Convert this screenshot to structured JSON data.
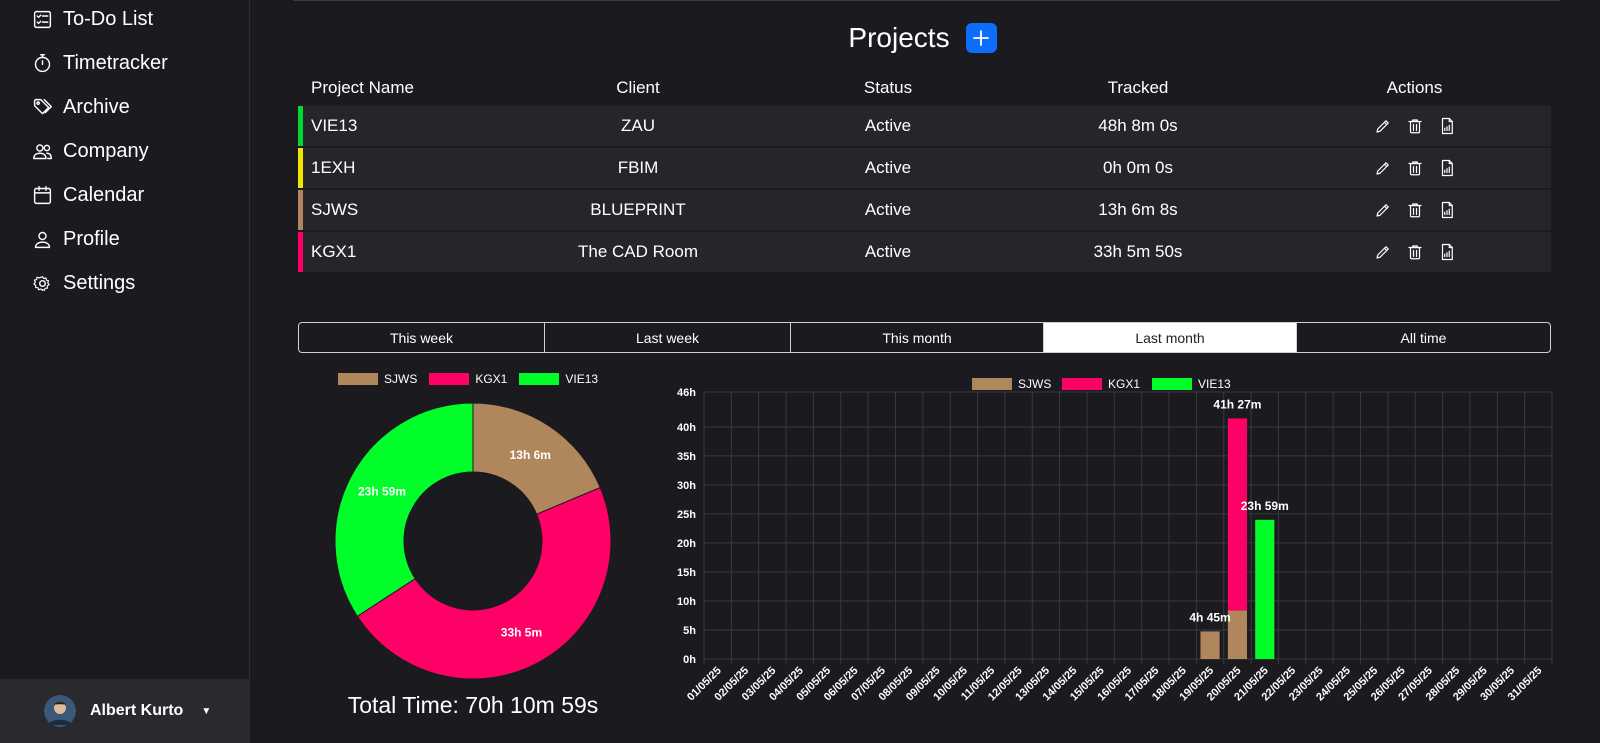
{
  "sidebar": {
    "items": [
      {
        "label": "To-Do List",
        "icon": "todo-list-icon"
      },
      {
        "label": "Timetracker",
        "icon": "stopwatch-icon"
      },
      {
        "label": "Archive",
        "icon": "tags-icon"
      },
      {
        "label": "Company",
        "icon": "people-icon"
      },
      {
        "label": "Calendar",
        "icon": "calendar-icon"
      },
      {
        "label": "Profile",
        "icon": "person-icon"
      },
      {
        "label": "Settings",
        "icon": "gear-icon"
      }
    ],
    "user": {
      "name": "Albert Kurto"
    }
  },
  "header": {
    "title": "Projects"
  },
  "table": {
    "columns": [
      "Project Name",
      "Client",
      "Status",
      "Tracked",
      "Actions"
    ],
    "rows": [
      {
        "name": "VIE13",
        "client": "ZAU",
        "status": "Active",
        "tracked": "48h 8m 0s",
        "color": "#00d92f"
      },
      {
        "name": "1EXH",
        "client": "FBIM",
        "status": "Active",
        "tracked": "0h 0m 0s",
        "color": "#f2e600"
      },
      {
        "name": "SJWS",
        "client": "BLUEPRINT",
        "status": "Active",
        "tracked": "13h 6m 8s",
        "color": "#b0865d"
      },
      {
        "name": "KGX1",
        "client": "The CAD Room",
        "status": "Active",
        "tracked": "33h 5m 50s",
        "color": "#ff0066"
      }
    ]
  },
  "periods": {
    "tabs": [
      "This week",
      "Last week",
      "This month",
      "Last month",
      "All time"
    ],
    "active": "Last month"
  },
  "chart_data": [
    {
      "type": "pie",
      "variant": "doughnut",
      "labels": [
        "SJWS",
        "KGX1",
        "VIE13"
      ],
      "values_minutes": [
        786,
        1985,
        1439
      ],
      "slice_labels": [
        "13h 6m",
        "33h 5m",
        "23h 59m"
      ],
      "colors": [
        "#b0865d",
        "#ff0066",
        "#00ff2a"
      ],
      "total_label": "Total Time: 70h 10m 59s",
      "legend": "top"
    },
    {
      "type": "bar",
      "stacked": true,
      "categories": [
        "01/05/25",
        "02/05/25",
        "03/05/25",
        "04/05/25",
        "05/05/25",
        "06/05/25",
        "07/05/25",
        "08/05/25",
        "09/05/25",
        "10/05/25",
        "11/05/25",
        "12/05/25",
        "13/05/25",
        "14/05/25",
        "15/05/25",
        "16/05/25",
        "17/05/25",
        "18/05/25",
        "19/05/25",
        "20/05/25",
        "21/05/25",
        "22/05/25",
        "23/05/25",
        "24/05/25",
        "25/05/25",
        "26/05/25",
        "27/05/25",
        "28/05/25",
        "29/05/25",
        "30/05/25",
        "31/05/25"
      ],
      "series": [
        {
          "name": "SJWS",
          "color": "#b0865d",
          "values": [
            0,
            0,
            0,
            0,
            0,
            0,
            0,
            0,
            0,
            0,
            0,
            0,
            0,
            0,
            0,
            0,
            0,
            0,
            4.75,
            8.35,
            0,
            0,
            0,
            0,
            0,
            0,
            0,
            0,
            0,
            0,
            0
          ]
        },
        {
          "name": "KGX1",
          "color": "#ff0066",
          "values": [
            0,
            0,
            0,
            0,
            0,
            0,
            0,
            0,
            0,
            0,
            0,
            0,
            0,
            0,
            0,
            0,
            0,
            0,
            0,
            33.1,
            0,
            0,
            0,
            0,
            0,
            0,
            0,
            0,
            0,
            0,
            0
          ]
        },
        {
          "name": "VIE13",
          "color": "#00ff2a",
          "values": [
            0,
            0,
            0,
            0,
            0,
            0,
            0,
            0,
            0,
            0,
            0,
            0,
            0,
            0,
            0,
            0,
            0,
            0,
            0,
            0,
            23.98,
            0,
            0,
            0,
            0,
            0,
            0,
            0,
            0,
            0,
            0
          ]
        }
      ],
      "total_labels": [
        {
          "category": "19/05/25",
          "text": "4h 45m"
        },
        {
          "category": "20/05/25",
          "text": "41h 27m"
        },
        {
          "category": "21/05/25",
          "text": "23h 59m"
        }
      ],
      "yticks": [
        "0h",
        "5h",
        "10h",
        "15h",
        "20h",
        "25h",
        "30h",
        "35h",
        "40h",
        "46h"
      ],
      "ylim": [
        0,
        46
      ],
      "grid": true,
      "legend": "top"
    }
  ]
}
